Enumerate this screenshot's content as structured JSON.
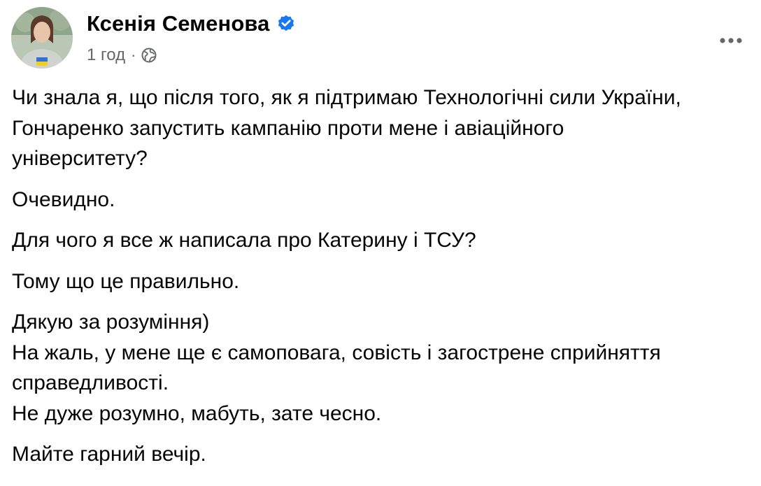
{
  "author": {
    "name": "Ксенія Семенова",
    "verified": true,
    "avatar_icon": "profile-photo"
  },
  "meta": {
    "time": "1 год",
    "separator": "·",
    "audience_icon": "globe-icon"
  },
  "menu": {
    "icon": "more-options-icon"
  },
  "colors": {
    "text": "#050505",
    "secondary": "#65676b",
    "verified_blue": "#1877f2"
  },
  "post": {
    "paragraphs": [
      {
        "lines": [
          "Чи знала я, що після того, як я підтримаю Технологічні сили України,",
          "Гончаренко запустить кампанію проти мене і авіаційного",
          "університету?"
        ]
      },
      {
        "lines": [
          "Очевидно."
        ]
      },
      {
        "lines": [
          "Для чого я все ж написала про Катерину і ТСУ?"
        ]
      },
      {
        "lines": [
          "Тому що це правильно."
        ]
      },
      {
        "lines": [
          "Дякую за розуміння)",
          "На жаль, у мене ще є самоповага, совість і загострене сприйняття",
          "справедливості.",
          "Не дуже розумно, мабуть, зате чесно."
        ]
      },
      {
        "lines": [
          "Майте гарний вечір."
        ]
      }
    ]
  }
}
